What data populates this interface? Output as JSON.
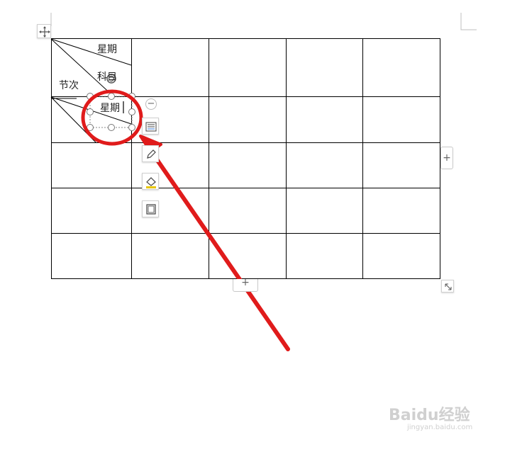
{
  "table": {
    "header_top_text": "星期",
    "header_middle_text": "科目",
    "header_left_text": "节次",
    "textbox_text": "星期"
  },
  "controls": {
    "row_add_label": "+",
    "column_add_label": "+",
    "remove_label": "−"
  },
  "watermark": {
    "brand": "Baidu经验",
    "domain": "jingyan.baidu.com"
  },
  "colors": {
    "annotation_red": "#e01b1b",
    "grid_line": "#000000",
    "handle_gray": "#777777"
  }
}
